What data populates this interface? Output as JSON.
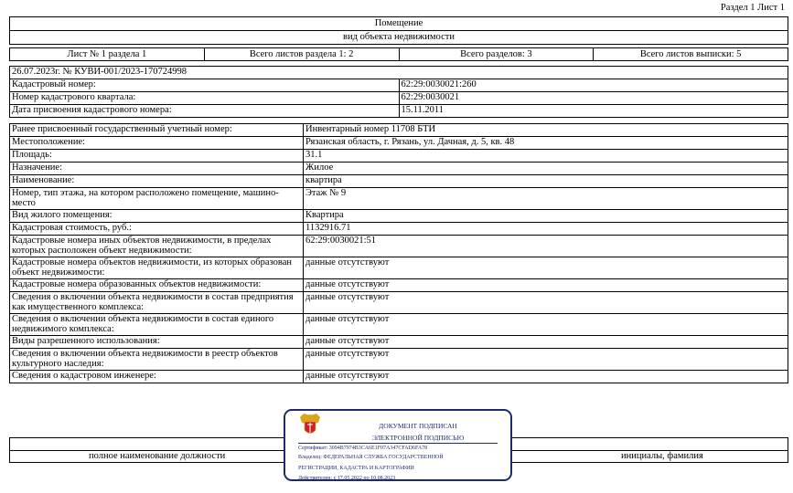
{
  "section_ref": "Раздел 1 Лист 1",
  "header": {
    "title": "Помещение",
    "subtitle": "вид объекта недвижимости"
  },
  "sheets": {
    "sheet": "Лист № 1 раздела 1",
    "total_sheets_section": "Всего листов раздела 1: 2",
    "total_sections": "Всего разделов: 3",
    "total_sheets_extract": "Всего листов выписки: 5"
  },
  "doc_ref": "26.07.2023г. № КУВИ-001/2023-170724998",
  "main_rows": [
    {
      "label": "Кадастровый номер:",
      "value": "62:29:0030021:260"
    },
    {
      "label": "Номер кадастрового квартала:",
      "value": "62:29:0030021"
    },
    {
      "label": "Дата присвоения кадастрового номера:",
      "value": "15.11.2011"
    }
  ],
  "detail_rows": [
    {
      "label": "Ранее присвоенный государственный учетный номер:",
      "value": "Инвентарный номер 11708 БТИ",
      "tall": false
    },
    {
      "label": "Местоположение:",
      "value": "Рязанская область, г. Рязань, ул. Дачная, д. 5, кв. 48",
      "tall": false
    },
    {
      "label": "Площадь:",
      "value": "31.1",
      "tall": false
    },
    {
      "label": "Назначение:",
      "value": "Жилое",
      "tall": false
    },
    {
      "label": "Наименование:",
      "value": "квартира",
      "tall": false
    },
    {
      "label": "Номер, тип этажа, на котором расположено помещение, машино-место",
      "value": "Этаж № 9",
      "tall": true
    },
    {
      "label": "Вид жилого помещения:",
      "value": "Квартира",
      "tall": false
    },
    {
      "label": "Кадастровая стоимость, руб.:",
      "value": "1132916.71",
      "tall": false
    },
    {
      "label": "Кадастровые номера иных объектов недвижимости, в пределах которых расположен объект недвижимости:",
      "value": "62:29:0030021:51",
      "tall": true
    },
    {
      "label": "Кадастровые номера объектов недвижимости, из которых образован объект недвижимости:",
      "value": "данные отсутствуют",
      "tall": true
    },
    {
      "label": "Кадастровые номера образованных объектов недвижимости:",
      "value": "данные отсутствуют",
      "tall": false
    },
    {
      "label": "Сведения о включении объекта недвижимости в состав предприятия как имущественного комплекса:",
      "value": "данные отсутствуют",
      "tall": true
    },
    {
      "label": "Сведения о включении объекта недвижимости в состав единого недвижимого комплекса:",
      "value": "данные отсутствуют",
      "tall": true
    },
    {
      "label": "Виды разрешенного использования:",
      "value": "данные отсутствуют",
      "tall": false
    },
    {
      "label": "Сведения о включении объекта недвижимости в реестр объектов культурного наследия:",
      "value": "данные отсутствуют",
      "tall": true
    },
    {
      "label": "Сведения о кадастровом инженере:",
      "value": "данные отсутствуют",
      "tall": false
    }
  ],
  "footer": {
    "position_label": "полное наименование должности",
    "name_label": "инициалы, фамилия"
  },
  "stamp": {
    "line1": "ДОКУМЕНТ ПОДПИСАН",
    "line2": "ЭЛЕКТРОННОЙ ПОДПИСЬЮ",
    "certificate": "Сертификат: 3094B7974B3CA6E1F07A347CFAD6FA78",
    "owner_line1": "Владелец: ФЕДЕРАЛЬНАЯ СЛУЖБА ГОСУДАРСТВЕННОЙ",
    "owner_line2": "РЕГИСТРАЦИИ, КАДАСТРА И КАРТОГРАФИИ",
    "valid": "Действителен: с 17.05.2022 по 10.08.2023"
  },
  "colors": {
    "stamp": "#1e2a6e",
    "emblem_red": "#c8202a",
    "emblem_gold": "#d9a520"
  }
}
